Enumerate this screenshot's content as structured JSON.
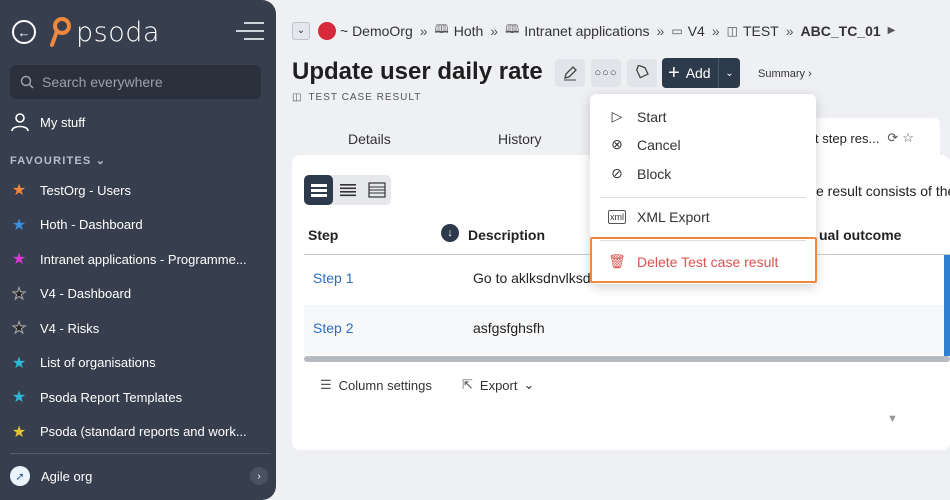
{
  "sidebar": {
    "logo": "psoda",
    "search_placeholder": "Search everywhere",
    "my_stuff": "My stuff",
    "favourites_heading": "FAVOURITES",
    "favourites": [
      {
        "label": "TestOrg - Users",
        "color": "#f0883e"
      },
      {
        "label": "Hoth - Dashboard",
        "color": "#3b8fe0"
      },
      {
        "label": "Intranet applications - Programme...",
        "color": "#d63ad0"
      },
      {
        "label": "V4 - Dashboard",
        "color": "#222222"
      },
      {
        "label": "V4 - Risks",
        "color": "#222222"
      },
      {
        "label": "List of organisations",
        "color": "#2fb8d8"
      },
      {
        "label": "Psoda Report Templates",
        "color": "#2fb8d8"
      },
      {
        "label": "Psoda (standard reports and work...",
        "color": "#e8c43a"
      }
    ],
    "agile_org": "Agile org"
  },
  "breadcrumb": {
    "org": "~ DemoOrg",
    "items": [
      "Hoth",
      "Intranet applications",
      "V4",
      "TEST",
      "ABC_TC_01"
    ]
  },
  "page": {
    "title": "Update user daily rate",
    "subtitle": "TEST CASE RESULT",
    "add_label": "Add",
    "summary": "Summary ›"
  },
  "tabs": {
    "details": "Details",
    "history": "History",
    "active": "t step res..."
  },
  "card": {
    "note": "e result consists of the",
    "columns": {
      "step": "Step",
      "description": "Description",
      "outcome": "ual outcome"
    },
    "rows": [
      {
        "step": "Step 1",
        "description": "Go to aklksdnvlksd"
      },
      {
        "step": "Step 2",
        "description": "asfgsfghsfh"
      }
    ],
    "column_settings": "Column settings",
    "export": "Export"
  },
  "menu": {
    "start": "Start",
    "cancel": "Cancel",
    "block": "Block",
    "xml_export": "XML Export",
    "delete": "Delete Test case result"
  }
}
